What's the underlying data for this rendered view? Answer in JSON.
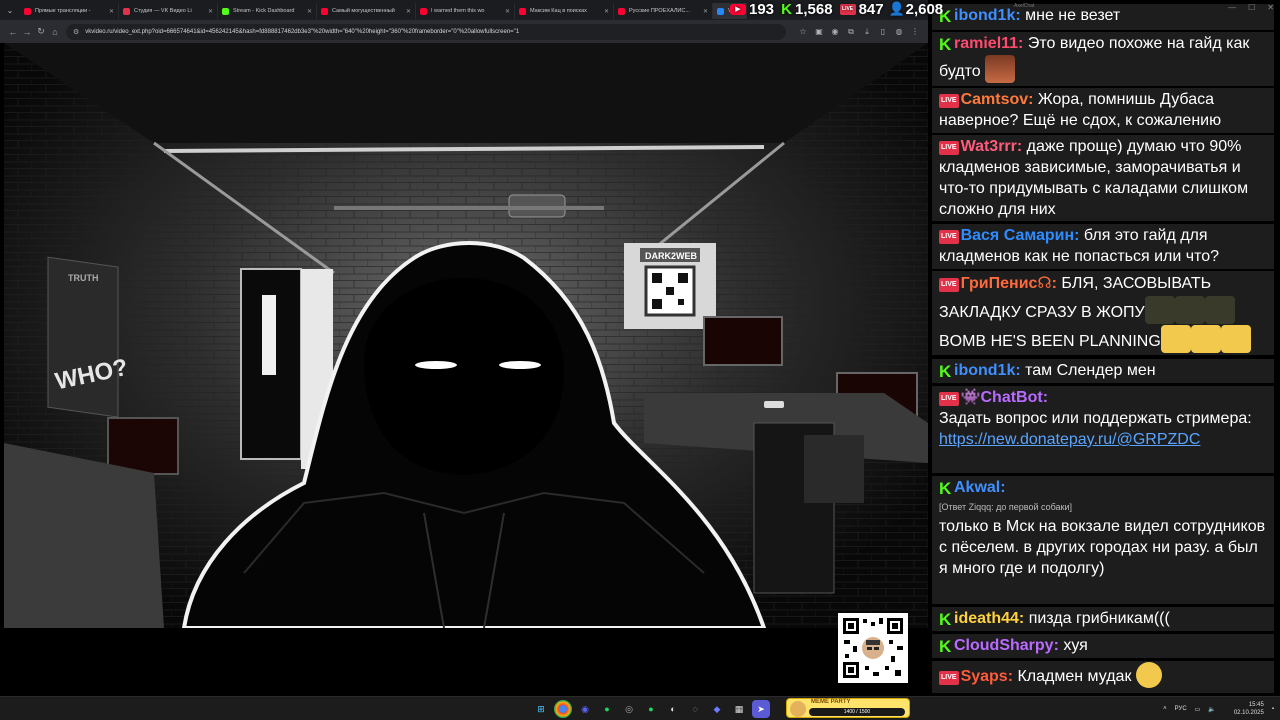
{
  "tabs": [
    {
      "title": "Прямые трансляции -",
      "color": "#ff0033"
    },
    {
      "title": "Студия — VK Видео Li",
      "color": "#e3314a"
    },
    {
      "title": "Stream - Kick Dashboard",
      "color": "#53fc18"
    },
    {
      "title": "Самый могущественный",
      "color": "#ff0033"
    },
    {
      "title": "I warned them this wo",
      "color": "#ff0033"
    },
    {
      "title": "Максим Кац в поисках",
      "color": "#ff0033"
    },
    {
      "title": "Русские ПРОЕХАЛИС...",
      "color": "#ff0033"
    },
    {
      "title": "VK",
      "color": "#2787f5"
    }
  ],
  "url": "vkvideo.ru/video_ext.php?oid=666574641&id=456242145&hash=fd888817462db3e3\"%20width=\"640\"%20height=\"360\"%20frameborder=\"0\"%20allowfullscreen=\"1",
  "video": {
    "posters": {
      "who": "WHO?",
      "truth": "TRUTH",
      "darkweb": "DARK2WEB"
    }
  },
  "stats": {
    "youtube": "193",
    "kick": "1,568",
    "vk": "847",
    "viewers": "2,608",
    "vk_icon": "LIVE"
  },
  "chat": {
    "app_name": "AxelChat",
    "messages": [
      {
        "platform": "kick",
        "nick": "ibond1k:",
        "nick_color": "#3f8fff",
        "text": "мне не везет"
      },
      {
        "platform": "kick",
        "nick": "ramiel11:",
        "nick_color": "#ff4b6e",
        "text": "Это видео похоже на гайд как будто"
      },
      {
        "platform": "vk",
        "nick": "Camtsov:",
        "nick_color": "#ff7a3c",
        "text": "Жора, помнишь Дубаса наверное? Ещё не сдох, к сожалению"
      },
      {
        "platform": "vk",
        "nick": "Wat3rrr:",
        "nick_color": "#ff5b7a",
        "text": "даже проще) думаю что 90% кладменов зависимые, заморачиватья и что-то придумывать с каладами слишком сложно для них"
      },
      {
        "platform": "vk",
        "nick": "Вася Самарин:",
        "nick_color": "#2f8cff",
        "text": "бля это гайд для кладменов как не попасться или что?"
      },
      {
        "platform": "vk",
        "nick": "ГриПенис☊:",
        "nick_color": "#ff6a3c",
        "text": "БЛЯ, ЗАСОВЫВАТЬ ЗАКЛАДКУ СРАЗУ В ЖОПУ",
        "text2": "BOMB HE'S BEEN PLANNING"
      },
      {
        "platform": "kick",
        "nick": "ibond1k:",
        "nick_color": "#3f8fff",
        "text": "там Слендер мен"
      },
      {
        "platform": "vk",
        "nick": "👾ChatBot:",
        "nick_color": "#b96bff",
        "text": "Задать вопрос или поддержать стримера:",
        "link": "https://new.donatepay.ru/@GRPZDC"
      },
      {
        "platform": "kick",
        "nick": "Akwal:",
        "nick_color": "#3f8fff",
        "reply": "[Ответ Ziqqq: до первой собаки]",
        "text": "только в Мск на вокзале видел сотрудников с пёселем. в других городах ни разу. а был я много где и подолгу)"
      },
      {
        "platform": "kick",
        "nick": "ideath44:",
        "nick_color": "#ffd23f",
        "text": "пизда грибникам((("
      },
      {
        "platform": "kick",
        "nick": "CloudSharpy:",
        "nick_color": "#b96bff",
        "text": "хуя"
      },
      {
        "platform": "vk",
        "nick": "Syaps:",
        "nick_color": "#ff5b3c",
        "text": "Кладмен мудак"
      }
    ]
  },
  "taskbar": {
    "meme_label": "MEME PARTY",
    "meme_progress": "1400 / 1500",
    "lang": "РУС",
    "time": "15:45",
    "date": "02.10.2025"
  }
}
